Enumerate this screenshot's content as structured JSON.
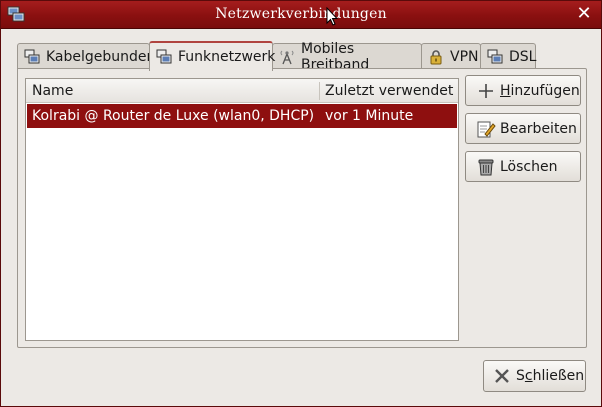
{
  "window": {
    "title": "Netzwerkverbindungen",
    "accent_color": "#8e0f0f",
    "title_icon": "network-connections-icon",
    "close_icon": "close-icon"
  },
  "tabs": [
    {
      "label": "Kabelgebunden",
      "icon": "wired-network-icon",
      "active": false
    },
    {
      "label": "Funknetzwerk",
      "icon": "wireless-network-icon",
      "active": true
    },
    {
      "label": "Mobiles Breitband",
      "icon": "mobile-broadband-icon",
      "active": false
    },
    {
      "label": "VPN",
      "icon": "vpn-lock-icon",
      "active": false
    },
    {
      "label": "DSL",
      "icon": "dsl-network-icon",
      "active": false
    }
  ],
  "list": {
    "columns": [
      "Name",
      "Zuletzt verwendet"
    ],
    "rows": [
      {
        "name": "Kolrabi @ Router de Luxe (wlan0, DHCP)",
        "last_used": "vor 1 Minute",
        "selected": true
      }
    ]
  },
  "buttons": {
    "add_mnemonic": "H",
    "add_rest": "inzufügen",
    "edit": "Bearbeiten",
    "delete": "Löschen"
  },
  "footer": {
    "close_pre": "S",
    "close_mnemonic": "c",
    "close_post": "hließen"
  }
}
